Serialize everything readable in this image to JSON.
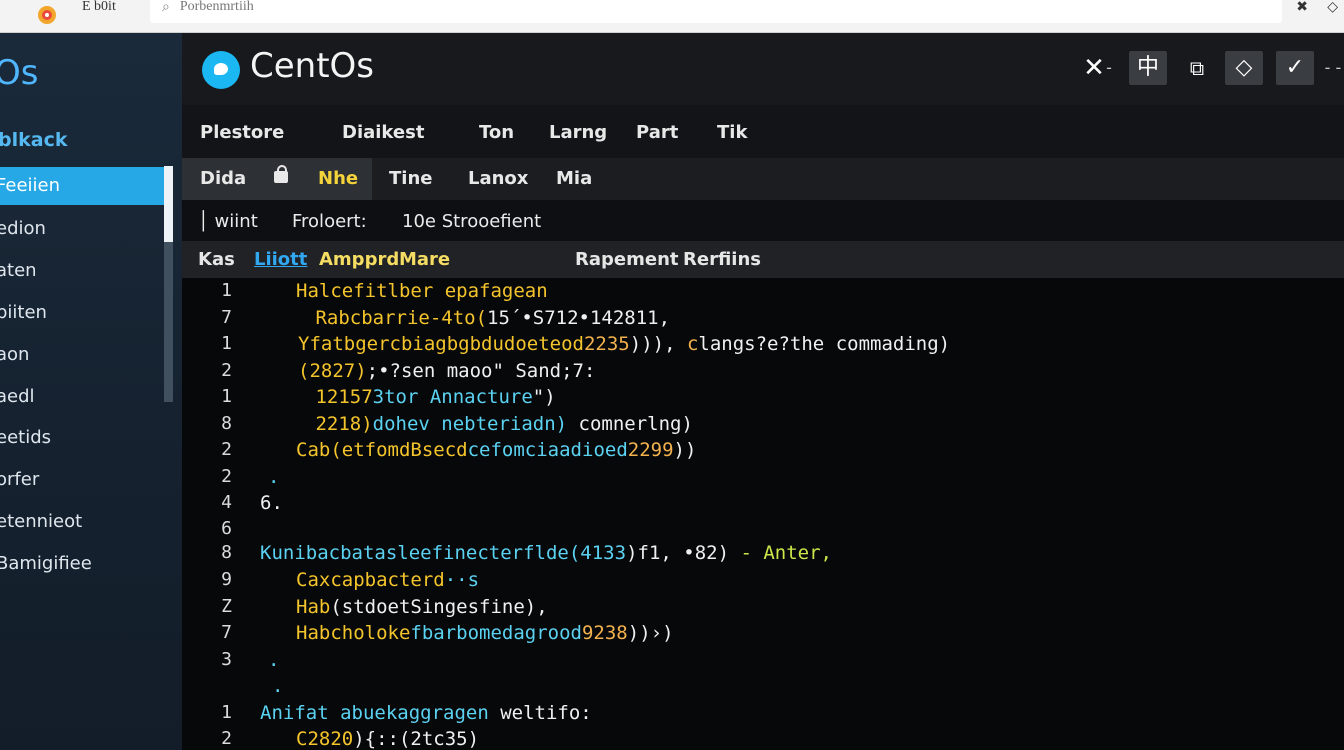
{
  "browser": {
    "tab_title": "Ë b0it",
    "address": "Porbenmrtiih",
    "search_glyph": "⌕",
    "pin_glyph": "✖",
    "diamond_glyph": "◇"
  },
  "sidebar": {
    "brand": "Os",
    "heading": "blkack",
    "items": [
      {
        "label": "Feeiien",
        "active": true
      },
      {
        "label": "edion"
      },
      {
        "label": "aten"
      },
      {
        "label": "piiten"
      },
      {
        "label": "aon"
      },
      {
        "label": "aedl"
      },
      {
        "label": "eetids"
      },
      {
        "label": "orfer"
      },
      {
        "label": "etennieot"
      },
      {
        "label": "Bamigifiee"
      }
    ]
  },
  "header": {
    "title": "CentOs",
    "close": "✕",
    "dash": "-",
    "zh": "中",
    "clip": "⧉",
    "diamond": "◇",
    "check": "✓",
    "dash2": "- -"
  },
  "menu": [
    "Plestore",
    "Diaikest",
    "Ton",
    "Larng",
    "Part",
    "Tik"
  ],
  "tabs": [
    "Dida",
    "Nhe",
    "Tine",
    "Lanox",
    "Mia"
  ],
  "status": {
    "left": "│ wiint",
    "middle": "Froloert:",
    "right": "10e Strooefient"
  },
  "toolbar": [
    "Kas",
    "Liiott",
    "Ampprd",
    "Mare",
    "Rapement",
    "Rerfiins"
  ],
  "accent": {
    "tab_blue": "#26a8e6",
    "code_yellow": "#f4c42c",
    "code_cyan": "#5bd2f2",
    "code_orange": "#f3b24e",
    "code_green": "#c9e84a"
  },
  "editor": {
    "lines": [
      {
        "n": "1",
        "segs": [
          {
            "t": "Halcefitlber epafagean",
            "c": "y"
          }
        ]
      },
      {
        "n": "7",
        "segs": [
          {
            "t": " Rabcbarrie-4to(",
            "c": "y"
          },
          {
            "t": "15´•S712•142811,",
            "c": "w"
          }
        ]
      },
      {
        "n": "1",
        "segs": [
          {
            "t": "Yfatbgercbiagbgbdudoeteod",
            "c": "y"
          },
          {
            "t": "2235",
            "c": "o"
          },
          {
            "t": "))",
            "c": "w"
          },
          {
            "t": "), ",
            "c": "w"
          },
          {
            "t": "c",
            "c": "o"
          },
          {
            "t": "langs?e?the commading)",
            "c": "w"
          }
        ]
      },
      {
        "n": "2",
        "segs": [
          {
            "t": "(2827)",
            "c": "y"
          },
          {
            "t": ";•?sen maoo\" Sand;7:",
            "c": "w"
          }
        ]
      },
      {
        "n": "1",
        "segs": [
          {
            "t": " 12157",
            "c": "y"
          },
          {
            "t": "3tor Annacture",
            "c": "c"
          },
          {
            "t": "\")",
            "c": "w"
          }
        ]
      },
      {
        "n": "8",
        "segs": [
          {
            "t": " 2218)",
            "c": "y"
          },
          {
            "t": "dohev nebteriadn) ",
            "c": "c"
          },
          {
            "t": "comnerlng)",
            "c": "w"
          }
        ]
      },
      {
        "n": "2",
        "segs": [
          {
            "t": "Cab",
            "c": "y"
          },
          {
            "t": "(etfomdBsecd",
            "c": "y"
          },
          {
            "t": "cefomciaadioed",
            "c": "c"
          },
          {
            "t": "2299",
            "c": "o"
          },
          {
            "t": "))",
            "c": "w"
          }
        ]
      },
      {
        "n": "2",
        "segs": [
          {
            "t": ".",
            "c": "c"
          }
        ]
      },
      {
        "n": "4",
        "segs": [
          {
            "t": "6.",
            "c": "w"
          }
        ]
      },
      {
        "n": "6",
        "segs": []
      },
      {
        "n": "8",
        "segs": [
          {
            "t": "Kunibacbatasleefinecterflde(",
            "c": "c"
          },
          {
            "t": "4133",
            "c": "c"
          },
          {
            "t": ")",
            "c": "w"
          },
          {
            "t": "f1, •82) ",
            "c": "w"
          },
          {
            "t": "- Anter,",
            "c": "g"
          }
        ]
      },
      {
        "n": "9",
        "segs": [
          {
            "t": "Caxcapbacterd",
            "c": "y"
          },
          {
            "t": "··s",
            "c": "c"
          }
        ]
      },
      {
        "n": "Z",
        "segs": [
          {
            "t": "Hab",
            "c": "y"
          },
          {
            "t": "(stdoetSingesfine),",
            "c": "w"
          }
        ]
      },
      {
        "n": "7",
        "segs": [
          {
            "t": "Habcholoke",
            "c": "y"
          },
          {
            "t": "fbarbomedagrood",
            "c": "c"
          },
          {
            "t": "9238",
            "c": "o"
          },
          {
            "t": "))›)",
            "c": "w"
          }
        ]
      },
      {
        "n": "3",
        "segs": [
          {
            "t": ".",
            "c": "c"
          }
        ]
      },
      {
        "n": "",
        "segs": [
          {
            "t": ".",
            "c": "c"
          }
        ]
      },
      {
        "n": "1",
        "segs": [
          {
            "t": "Anifat abuekaggragen",
            "c": "c"
          },
          {
            "t": " weltifo:",
            "c": "w"
          }
        ]
      },
      {
        "n": "2",
        "segs": [
          {
            "t": "C2820",
            "c": "y"
          },
          {
            "t": "){::(2tc35)",
            "c": "w"
          }
        ]
      }
    ]
  }
}
